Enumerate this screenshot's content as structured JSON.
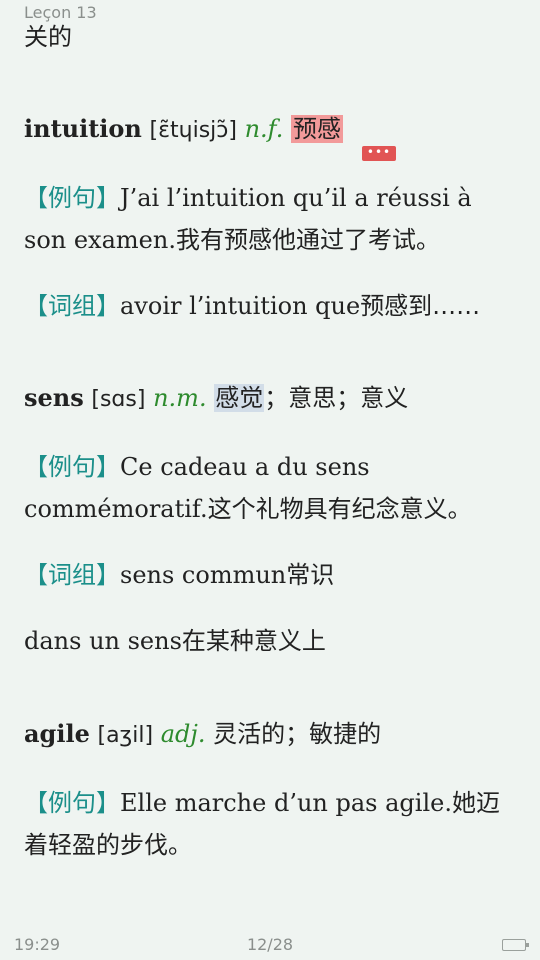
{
  "header": {
    "lesson": "Leçon 13"
  },
  "top_fragment": "关的",
  "entries": [
    {
      "word": "intuition",
      "pron": "[ɛ̃tɥisjɔ̃]",
      "pos": "n.f.",
      "meaning_highlight": "预感",
      "tooltip": "•••",
      "example_tag": "【例句】",
      "example": "J’ai l’intuition qu’il a réussi à son examen.",
      "example_cn": "我有预感他通过了考试。",
      "phrase_tag": "【词组】",
      "phrase": "avoir l’intuition que",
      "phrase_cn": "预感到……"
    },
    {
      "word": "sens",
      "pron": "[sɑs]",
      "pos": "n.m.",
      "meaning_highlight": "感觉",
      "meaning_rest": "；意思；意义",
      "example_tag": "【例句】",
      "example": "Ce cadeau a du sens commémoratif.",
      "example_cn": "这个礼物具有纪念意义。",
      "phrase_tag": "【词组】",
      "phrase": "sens commun",
      "phrase_cn": "常识",
      "phrase2": "dans un sens",
      "phrase2_cn": "在某种意义上"
    },
    {
      "word": "agile",
      "pron": "[aʒil]",
      "pos": "adj.",
      "meaning": "灵活的；敏捷的",
      "example_tag": "【例句】",
      "example": "Elle marche d’un pas agile.",
      "example_cn": "她迈着轻盈的步伐。"
    }
  ],
  "cut_line": "...",
  "footer": {
    "time": "19:29",
    "page": "12/28"
  }
}
